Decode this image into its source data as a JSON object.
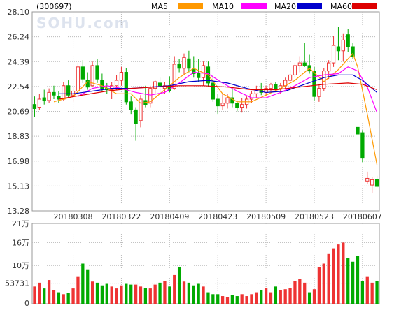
{
  "header": {
    "code": "(300697)",
    "legend": [
      {
        "label": "MA5",
        "color": "#ff9900"
      },
      {
        "label": "MA10",
        "color": "#ff00ff"
      },
      {
        "label": "MA20",
        "color": "#0000cc"
      },
      {
        "label": "MA60",
        "color": "#dd0000"
      }
    ]
  },
  "watermark": "SOHU.com",
  "colors": {
    "up": "#ee3333",
    "down": "#00aa00",
    "grid": "#bbbbbb",
    "text": "#333333"
  },
  "chart_data": [
    {
      "type": "candlestick",
      "title": "",
      "ylim": [
        13.28,
        28.1
      ],
      "y_ticks": [
        "28.10",
        "26.24",
        "24.39",
        "22.54",
        "20.69",
        "18.83",
        "16.98",
        "15.13",
        "13.28"
      ],
      "x_tick_labels": [
        "20180308",
        "20180322",
        "20180409",
        "20180423",
        "20180509",
        "20180523",
        "20180607"
      ],
      "x_tick_indices": [
        8,
        18,
        28,
        38,
        48,
        58,
        68
      ],
      "series_ohlc": [
        [
          21.2,
          21.8,
          20.3,
          20.9
        ],
        [
          21.0,
          22.0,
          20.8,
          21.6
        ],
        [
          21.7,
          22.3,
          21.2,
          21.5
        ],
        [
          21.5,
          22.4,
          21.3,
          22.1
        ],
        [
          22.1,
          22.6,
          21.6,
          21.9
        ],
        [
          21.8,
          22.2,
          21.3,
          21.6
        ],
        [
          21.6,
          22.9,
          21.5,
          22.6
        ],
        [
          22.6,
          23.0,
          21.7,
          21.9
        ],
        [
          21.9,
          22.5,
          21.4,
          22.2
        ],
        [
          22.2,
          24.3,
          22.1,
          24.0
        ],
        [
          24.0,
          24.5,
          22.8,
          23.1
        ],
        [
          23.0,
          23.6,
          22.3,
          22.5
        ],
        [
          22.6,
          24.4,
          22.5,
          24.1
        ],
        [
          24.1,
          24.6,
          22.8,
          23.1
        ],
        [
          23.0,
          23.5,
          22.2,
          22.4
        ],
        [
          22.4,
          22.8,
          22.0,
          22.3
        ],
        [
          22.3,
          22.9,
          21.6,
          22.6
        ],
        [
          22.6,
          23.4,
          22.3,
          23.0
        ],
        [
          23.0,
          24.0,
          22.6,
          23.6
        ],
        [
          23.6,
          23.9,
          21.2,
          21.4
        ],
        [
          21.4,
          21.8,
          20.5,
          20.8
        ],
        [
          20.8,
          21.0,
          18.5,
          19.8
        ],
        [
          20.0,
          21.9,
          19.5,
          21.6
        ],
        [
          21.5,
          22.6,
          21.0,
          21.2
        ],
        [
          21.3,
          22.6,
          21.0,
          22.4
        ],
        [
          22.4,
          23.0,
          22.0,
          22.9
        ],
        [
          22.8,
          23.2,
          22.0,
          22.6
        ],
        [
          22.4,
          22.9,
          22.0,
          22.6
        ],
        [
          22.6,
          23.3,
          22.1,
          22.2
        ],
        [
          22.4,
          24.8,
          22.3,
          24.2
        ],
        [
          24.2,
          24.6,
          23.6,
          23.9
        ],
        [
          23.9,
          25.0,
          23.4,
          24.7
        ],
        [
          24.6,
          25.2,
          23.6,
          23.9
        ],
        [
          23.8,
          24.8,
          23.2,
          23.5
        ],
        [
          23.5,
          24.6,
          22.9,
          23.2
        ],
        [
          23.2,
          24.4,
          22.6,
          24.1
        ],
        [
          24.0,
          24.4,
          22.5,
          22.8
        ],
        [
          22.8,
          23.4,
          21.4,
          21.6
        ],
        [
          21.6,
          22.0,
          20.5,
          21.1
        ],
        [
          21.1,
          22.0,
          20.8,
          21.3
        ],
        [
          21.3,
          22.0,
          20.9,
          21.7
        ],
        [
          21.7,
          22.4,
          21.0,
          21.3
        ],
        [
          21.3,
          21.5,
          20.7,
          21.0
        ],
        [
          21.0,
          21.7,
          20.6,
          21.2
        ],
        [
          21.2,
          21.8,
          20.9,
          21.6
        ],
        [
          21.6,
          22.2,
          21.3,
          22.0
        ],
        [
          22.0,
          22.6,
          21.7,
          22.3
        ],
        [
          22.3,
          22.8,
          21.9,
          22.1
        ],
        [
          22.1,
          22.6,
          21.8,
          22.4
        ],
        [
          22.4,
          22.8,
          22.1,
          22.7
        ],
        [
          22.7,
          22.9,
          22.2,
          22.4
        ],
        [
          22.4,
          22.8,
          22.0,
          22.6
        ],
        [
          22.6,
          23.2,
          22.4,
          23.0
        ],
        [
          23.0,
          23.8,
          22.8,
          23.4
        ],
        [
          23.4,
          24.3,
          23.2,
          24.1
        ],
        [
          24.1,
          24.8,
          23.6,
          24.3
        ],
        [
          24.3,
          25.8,
          24.0,
          24.1
        ],
        [
          24.1,
          24.9,
          23.5,
          23.7
        ],
        [
          23.7,
          24.0,
          21.5,
          21.8
        ],
        [
          21.8,
          22.7,
          21.4,
          22.4
        ],
        [
          22.4,
          23.9,
          22.2,
          23.7
        ],
        [
          23.7,
          24.5,
          23.1,
          24.3
        ],
        [
          24.3,
          26.3,
          24.0,
          25.6
        ],
        [
          25.5,
          27.0,
          24.5,
          25.2
        ],
        [
          25.2,
          26.5,
          24.4,
          26.0
        ],
        [
          26.4,
          26.8,
          25.1,
          25.5
        ],
        [
          25.5,
          25.8,
          24.6,
          24.8
        ],
        [
          19.5,
          19.5,
          19.0,
          19.0
        ],
        [
          19.1,
          19.3,
          16.9,
          17.2
        ],
        [
          15.5,
          16.2,
          15.3,
          15.7
        ],
        [
          15.2,
          15.8,
          14.6,
          15.6
        ],
        [
          15.6,
          15.9,
          15.0,
          15.1
        ]
      ],
      "ma_lines": [
        {
          "name": "MA5",
          "color": "#ff9900",
          "points": [
            [
              4,
              21.4
            ],
            [
              8,
              21.8
            ],
            [
              11,
              22.9
            ],
            [
              14,
              22.6
            ],
            [
              17,
              22.0
            ],
            [
              20,
              22.0
            ],
            [
              22,
              21.3
            ],
            [
              24,
              21.4
            ],
            [
              27,
              22.3
            ],
            [
              30,
              23.2
            ],
            [
              33,
              23.9
            ],
            [
              36,
              23.4
            ],
            [
              39,
              22.0
            ],
            [
              42,
              21.4
            ],
            [
              45,
              21.4
            ],
            [
              48,
              21.9
            ],
            [
              51,
              22.4
            ],
            [
              54,
              23.0
            ],
            [
              57,
              23.9
            ],
            [
              60,
              22.9
            ],
            [
              63,
              23.8
            ],
            [
              66,
              25.0
            ],
            [
              67,
              24.0
            ],
            [
              69,
              20.5
            ],
            [
              71,
              16.7
            ]
          ]
        },
        {
          "name": "MA10",
          "color": "#ff00ff",
          "points": [
            [
              9,
              21.8
            ],
            [
              12,
              22.4
            ],
            [
              15,
              22.6
            ],
            [
              18,
              22.4
            ],
            [
              21,
              22.1
            ],
            [
              24,
              21.9
            ],
            [
              27,
              22.1
            ],
            [
              30,
              22.8
            ],
            [
              33,
              23.6
            ],
            [
              36,
              23.5
            ],
            [
              39,
              22.8
            ],
            [
              42,
              22.2
            ],
            [
              45,
              21.7
            ],
            [
              48,
              21.7
            ],
            [
              51,
              22.1
            ],
            [
              54,
              22.6
            ],
            [
              57,
              23.2
            ],
            [
              60,
              23.4
            ],
            [
              63,
              23.5
            ],
            [
              65,
              24.0
            ],
            [
              67,
              23.7
            ],
            [
              69,
              22.5
            ],
            [
              71,
              20.6
            ]
          ]
        },
        {
          "name": "MA20",
          "color": "#0000cc",
          "points": [
            [
              5,
              22.0
            ],
            [
              8,
              22.0
            ],
            [
              12,
              22.2
            ],
            [
              16,
              22.4
            ],
            [
              20,
              22.4
            ],
            [
              24,
              22.5
            ],
            [
              28,
              22.6
            ],
            [
              32,
              22.9
            ],
            [
              36,
              23.0
            ],
            [
              40,
              22.8
            ],
            [
              44,
              22.4
            ],
            [
              48,
              22.1
            ],
            [
              52,
              22.2
            ],
            [
              56,
              22.7
            ],
            [
              60,
              23.2
            ],
            [
              63,
              23.4
            ],
            [
              66,
              23.4
            ],
            [
              68,
              23.0
            ],
            [
              71,
              22.1
            ]
          ]
        },
        {
          "name": "MA60",
          "color": "#dd0000",
          "points": [
            [
              5,
              21.6
            ],
            [
              10,
              21.9
            ],
            [
              15,
              22.2
            ],
            [
              20,
              22.4
            ],
            [
              25,
              22.5
            ],
            [
              30,
              22.6
            ],
            [
              35,
              22.6
            ],
            [
              40,
              22.5
            ],
            [
              45,
              22.3
            ],
            [
              50,
              22.3
            ],
            [
              55,
              22.5
            ],
            [
              60,
              22.7
            ],
            [
              65,
              22.8
            ],
            [
              68,
              22.7
            ],
            [
              71,
              22.3
            ]
          ]
        }
      ]
    },
    {
      "type": "bar",
      "title": "",
      "ylim": [
        0,
        210000
      ],
      "y_ticks": [
        "21万",
        "16万",
        "10万",
        "53731",
        "0"
      ],
      "values": [
        45000,
        55000,
        40000,
        62000,
        35000,
        30000,
        25000,
        28000,
        40000,
        70000,
        105000,
        90000,
        58000,
        55000,
        48000,
        52000,
        45000,
        40000,
        48000,
        52000,
        50000,
        50000,
        45000,
        42000,
        40000,
        50000,
        55000,
        60000,
        45000,
        75000,
        95000,
        58000,
        55000,
        48000,
        52000,
        45000,
        30000,
        25000,
        25000,
        20000,
        18000,
        22000,
        20000,
        25000,
        20000,
        25000,
        30000,
        35000,
        42000,
        30000,
        45000,
        35000,
        38000,
        42000,
        60000,
        65000,
        55000,
        30000,
        38000,
        95000,
        105000,
        130000,
        145000,
        155000,
        160000,
        120000,
        110000,
        125000,
        60000,
        70000,
        55000,
        60000
      ],
      "up": [
        true,
        true,
        false,
        true,
        true,
        false,
        true,
        false,
        true,
        true,
        false,
        false,
        true,
        false,
        false,
        false,
        true,
        true,
        true,
        false,
        false,
        true,
        true,
        false,
        true,
        true,
        false,
        true,
        false,
        true,
        false,
        true,
        false,
        false,
        false,
        true,
        false,
        false,
        false,
        true,
        true,
        false,
        false,
        true,
        true,
        true,
        true,
        false,
        true,
        true,
        false,
        true,
        true,
        true,
        true,
        true,
        true,
        false,
        true,
        true,
        true,
        true,
        true,
        true,
        true,
        false,
        false,
        false,
        false,
        true,
        true,
        false
      ]
    }
  ]
}
